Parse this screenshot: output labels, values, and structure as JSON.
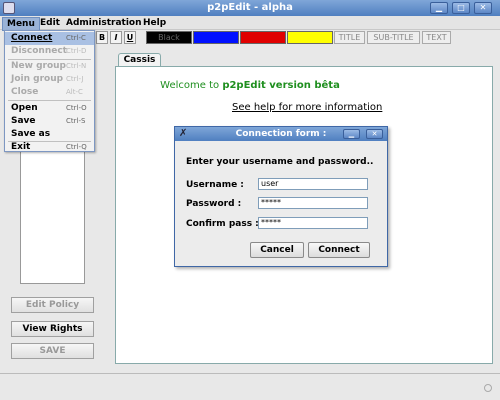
{
  "window": {
    "title": "p2pEdit - alpha"
  },
  "menubar": {
    "items": [
      {
        "label": "Menu"
      },
      {
        "label": "Edit"
      },
      {
        "label": "Administration"
      },
      {
        "label": "Help"
      }
    ]
  },
  "file_menu": {
    "items": [
      {
        "label": "Connect",
        "shortcut": "Ctrl-C",
        "enabled": true,
        "highlighted": true
      },
      {
        "label": "Disconnect",
        "shortcut": "Ctrl-D",
        "enabled": false
      },
      {
        "label": "New group",
        "shortcut": "Ctrl-N",
        "enabled": false
      },
      {
        "label": "Join group",
        "shortcut": "Ctrl-J",
        "enabled": false
      },
      {
        "label": "Close",
        "shortcut": "Alt-C",
        "enabled": false
      },
      {
        "label": "Open",
        "shortcut": "Ctrl-O",
        "enabled": true
      },
      {
        "label": "Save",
        "shortcut": "Ctrl-S",
        "enabled": true
      },
      {
        "label": "Save as",
        "shortcut": "",
        "enabled": true
      },
      {
        "label": "Exit",
        "shortcut": "Ctrl-Q",
        "enabled": true
      }
    ]
  },
  "toolbar": {
    "bold": "B",
    "italic": "I",
    "underline": "U",
    "colors": [
      {
        "label": "Black",
        "hex": "#000000"
      },
      {
        "label": "",
        "hex": "#0010ff"
      },
      {
        "label": "",
        "hex": "#e00000"
      },
      {
        "label": "",
        "hex": "#ffff00"
      }
    ],
    "title_btn": "TITLE",
    "subtitle_btn": "SUB-TITLE",
    "text_btn": "TEXT"
  },
  "side_buttons": {
    "edit_policy": "Edit Policy",
    "view_rights": "View Rights",
    "save": "SAVE"
  },
  "tabs": [
    {
      "label": "Cassis"
    }
  ],
  "document": {
    "welcome_prefix": "Welcome to",
    "welcome_app": "p2pEdit version bêta",
    "help_link": "See help for more information"
  },
  "dialog": {
    "title": "Connection form :",
    "prompt": "Enter your username and password..",
    "username_label": "Username :",
    "username_value": "user",
    "password_label": "Password :",
    "password_value": "*****",
    "confirm_label": "Confirm pass :",
    "confirm_value": "*****",
    "cancel": "Cancel",
    "connect": "Connect"
  },
  "icons": [
    "app-icon",
    "minimize-icon",
    "maximize-icon",
    "close-icon",
    "dialog-x-icon"
  ]
}
